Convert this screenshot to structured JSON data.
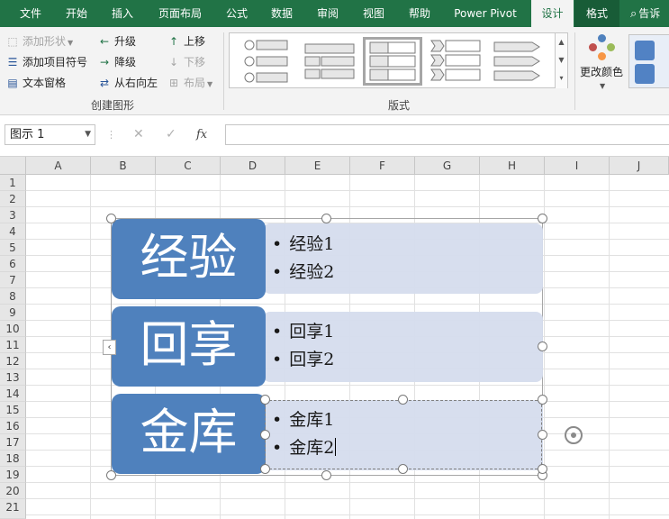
{
  "ribbon_tabs": [
    "文件",
    "开始",
    "插入",
    "页面布局",
    "公式",
    "数据",
    "审阅",
    "视图",
    "帮助",
    "Power Pivot",
    "设计",
    "格式"
  ],
  "tell_me": "告诉",
  "create_group": {
    "add_shape": "添加形状",
    "add_bullet": "添加项目符号",
    "text_pane": "文本窗格",
    "promote": "升级",
    "demote": "降级",
    "right_to_left": "从右向左",
    "move_up": "上移",
    "move_down": "下移",
    "layout": "布局",
    "label": "创建图形"
  },
  "layouts_group": {
    "label": "版式"
  },
  "change_colors": "更改颜色",
  "formula_bar": {
    "name_box": "图示 1",
    "fx": "fx",
    "value": ""
  },
  "columns": [
    "A",
    "B",
    "C",
    "D",
    "E",
    "F",
    "G",
    "H",
    "I",
    "J"
  ],
  "rows": [
    "1",
    "2",
    "3",
    "4",
    "5",
    "6",
    "7",
    "8",
    "9",
    "10",
    "11",
    "12",
    "13",
    "14",
    "15",
    "16",
    "17",
    "18",
    "19",
    "20",
    "21"
  ],
  "smartart": {
    "items": [
      {
        "title": "经验",
        "bullets": [
          "经验1",
          "经验2"
        ]
      },
      {
        "title": "回享",
        "bullets": [
          "回享1",
          "回享2"
        ]
      },
      {
        "title": "金库",
        "bullets": [
          "金库1",
          "金库2"
        ]
      }
    ]
  },
  "colors": {
    "accent": "#217346",
    "block": "#4f81bd",
    "block_light": "#d5dced"
  }
}
